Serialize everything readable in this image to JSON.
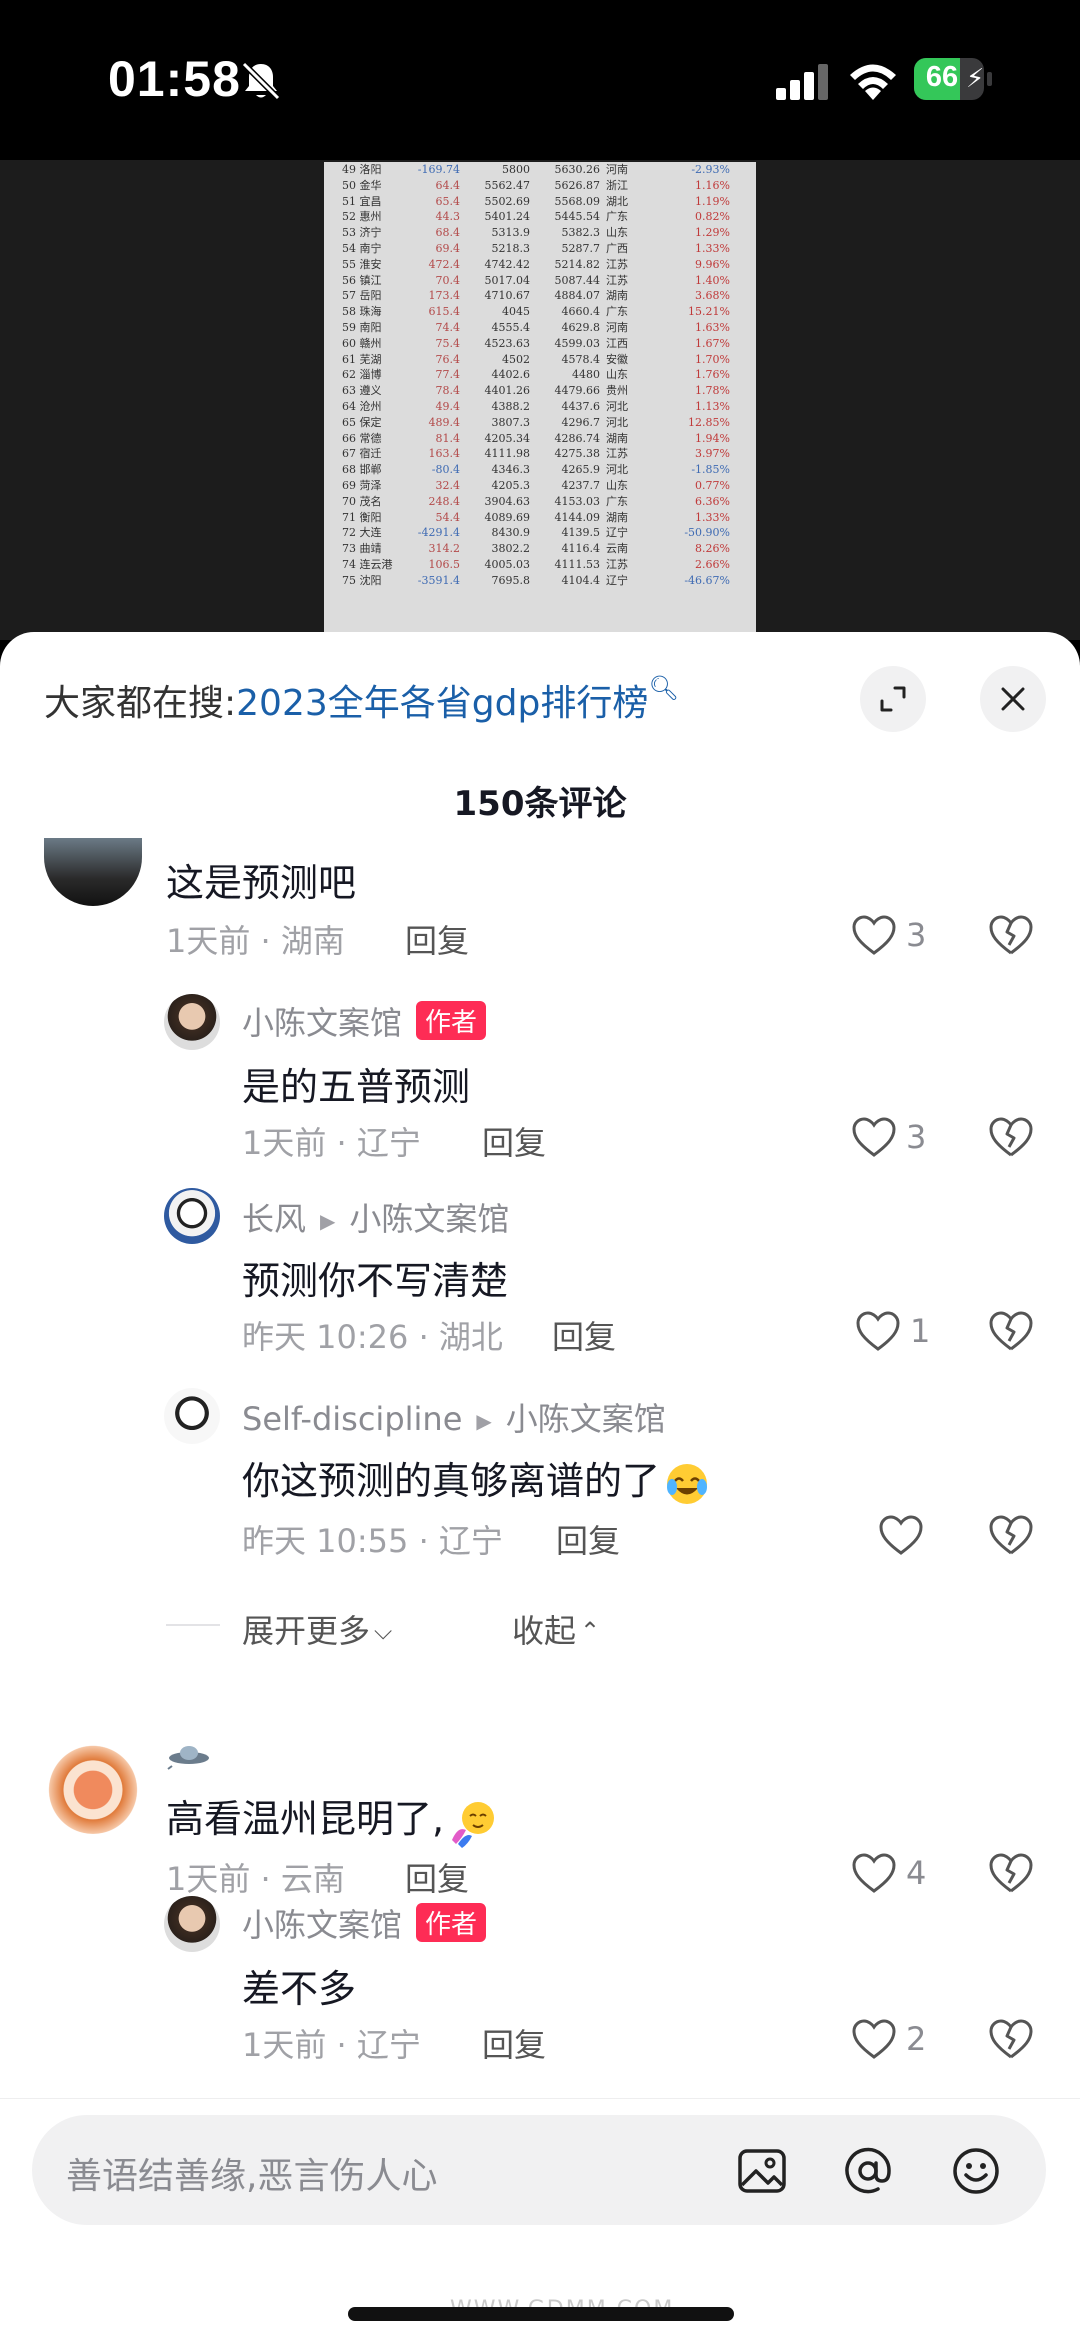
{
  "status_bar": {
    "time": "01:58",
    "battery": "66",
    "battery_level": 0.66
  },
  "video_doc": {
    "rows": [
      [
        "49 洛阳",
        "-169.74",
        "5800",
        "5630.26",
        "河南",
        "-2.93%"
      ],
      [
        "50 金华",
        "64.4",
        "5562.47",
        "5626.87",
        "浙江",
        "1.16%"
      ],
      [
        "51 宜昌",
        "65.4",
        "5502.69",
        "5568.09",
        "湖北",
        "1.19%"
      ],
      [
        "52 惠州",
        "44.3",
        "5401.24",
        "5445.54",
        "广东",
        "0.82%"
      ],
      [
        "53 济宁",
        "68.4",
        "5313.9",
        "5382.3",
        "山东",
        "1.29%"
      ],
      [
        "54 南宁",
        "69.4",
        "5218.3",
        "5287.7",
        "广西",
        "1.33%"
      ],
      [
        "55 淮安",
        "472.4",
        "4742.42",
        "5214.82",
        "江苏",
        "9.96%"
      ],
      [
        "56 镇江",
        "70.4",
        "5017.04",
        "5087.44",
        "江苏",
        "1.40%"
      ],
      [
        "57 岳阳",
        "173.4",
        "4710.67",
        "4884.07",
        "湖南",
        "3.68%"
      ],
      [
        "58 珠海",
        "615.4",
        "4045",
        "4660.4",
        "广东",
        "15.21%"
      ],
      [
        "59 南阳",
        "74.4",
        "4555.4",
        "4629.8",
        "河南",
        "1.63%"
      ],
      [
        "60 赣州",
        "75.4",
        "4523.63",
        "4599.03",
        "江西",
        "1.67%"
      ],
      [
        "61 芜湖",
        "76.4",
        "4502",
        "4578.4",
        "安徽",
        "1.70%"
      ],
      [
        "62 淄博",
        "77.4",
        "4402.6",
        "4480",
        "山东",
        "1.76%"
      ],
      [
        "63 遵义",
        "78.4",
        "4401.26",
        "4479.66",
        "贵州",
        "1.78%"
      ],
      [
        "64 沧州",
        "49.4",
        "4388.2",
        "4437.6",
        "河北",
        "1.13%"
      ],
      [
        "65 保定",
        "489.4",
        "3807.3",
        "4296.7",
        "河北",
        "12.85%"
      ],
      [
        "66 常德",
        "81.4",
        "4205.34",
        "4286.74",
        "湖南",
        "1.94%"
      ],
      [
        "67 宿迁",
        "163.4",
        "4111.98",
        "4275.38",
        "江苏",
        "3.97%"
      ],
      [
        "68 邯郸",
        "-80.4",
        "4346.3",
        "4265.9",
        "河北",
        "-1.85%"
      ],
      [
        "69 菏泽",
        "32.4",
        "4205.3",
        "4237.7",
        "山东",
        "0.77%"
      ],
      [
        "70 茂名",
        "248.4",
        "3904.63",
        "4153.03",
        "广东",
        "6.36%"
      ],
      [
        "71 衡阳",
        "54.4",
        "4089.69",
        "4144.09",
        "湖南",
        "1.33%"
      ],
      [
        "72 大连",
        "-4291.4",
        "8430.9",
        "4139.5",
        "辽宁",
        "-50.90%"
      ],
      [
        "73 曲靖",
        "314.2",
        "3802.2",
        "4116.4",
        "云南",
        "8.26%"
      ],
      [
        "74 连云港",
        "106.5",
        "4005.03",
        "4111.53",
        "江苏",
        "2.66%"
      ],
      [
        "75 沈阳",
        "-3591.4",
        "7695.8",
        "4104.4",
        "辽宁",
        "-46.67%"
      ]
    ]
  },
  "sheet": {
    "search_prefix": "大家都在搜:",
    "search_link": "2023全年各省gdp排行榜",
    "comment_count": "150条评论"
  },
  "comments": {
    "c1": {
      "text": "这是预测吧",
      "meta": "1天前 · 湖南",
      "reply": "回复",
      "likes": "3"
    },
    "c1r1": {
      "user": "小陈文案馆",
      "tag": "作者",
      "text": "是的五普预测",
      "meta": "1天前 · 辽宁",
      "reply": "回复",
      "likes": "3"
    },
    "c1r2": {
      "user": "长风",
      "target": "小陈文案馆",
      "text": "预测你不写清楚",
      "meta": "昨天 10:26 · 湖北",
      "reply": "回复",
      "likes": "1"
    },
    "c1r3": {
      "user": "Self-discipline",
      "target": "小陈文案馆",
      "text": "你这预测的真够离谱的了",
      "meta": "昨天 10:55 · 辽宁",
      "reply": "回复"
    },
    "expand_more": "展开更多",
    "collapse": "收起",
    "c2": {
      "text": "高看温州昆明了,",
      "meta": "1天前 · 云南",
      "reply": "回复",
      "likes": "4"
    },
    "c2r1": {
      "user": "小陈文案馆",
      "tag": "作者",
      "text": "差不多",
      "meta": "1天前 · 辽宁",
      "reply": "回复",
      "likes": "2"
    }
  },
  "input": {
    "placeholder": "善语结善缘,恶言伤人心"
  },
  "watermark": "WWW.GDMM.COM",
  "colors": {
    "accent": "#fe2c55",
    "link": "#1a5fa8",
    "battery": "#34c759"
  }
}
